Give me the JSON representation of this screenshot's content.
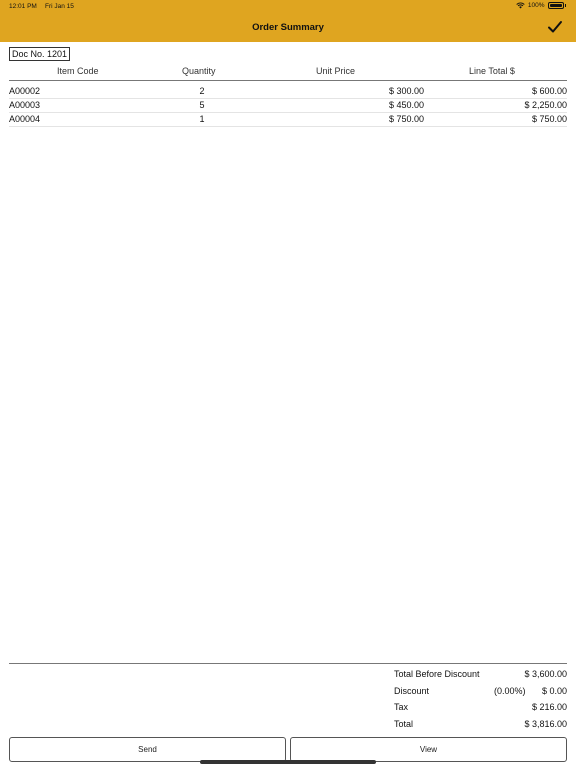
{
  "status": {
    "time": "12:01 PM",
    "date": "Fri Jan 15",
    "battery": "100%",
    "battery_level": 1.0
  },
  "nav": {
    "title": "Order Summary"
  },
  "doc": {
    "number": "Doc No. 1201"
  },
  "table": {
    "headers": {
      "code": "Item Code",
      "qty": "Quantity",
      "price": "Unit Price",
      "total": "Line Total $"
    },
    "rows": [
      {
        "code": "A00002",
        "qty": "2",
        "price": "$ 300.00",
        "total": "$ 600.00"
      },
      {
        "code": "A00003",
        "qty": "5",
        "price": "$ 450.00",
        "total": "$ 2,250.00"
      },
      {
        "code": "A00004",
        "qty": "1",
        "price": "$ 750.00",
        "total": "$ 750.00"
      }
    ]
  },
  "totals": {
    "before_discount_label": "Total Before Discount",
    "before_discount_value": "$ 3,600.00",
    "discount_label": "Discount",
    "discount_pct": "(0.00%)",
    "discount_value": "$ 0.00",
    "tax_label": "Tax",
    "tax_value": "$ 216.00",
    "total_label": "Total",
    "total_value": "$ 3,816.00"
  },
  "buttons": {
    "send": "Send",
    "view": "View"
  },
  "colors": {
    "accent": "#DFA520"
  }
}
